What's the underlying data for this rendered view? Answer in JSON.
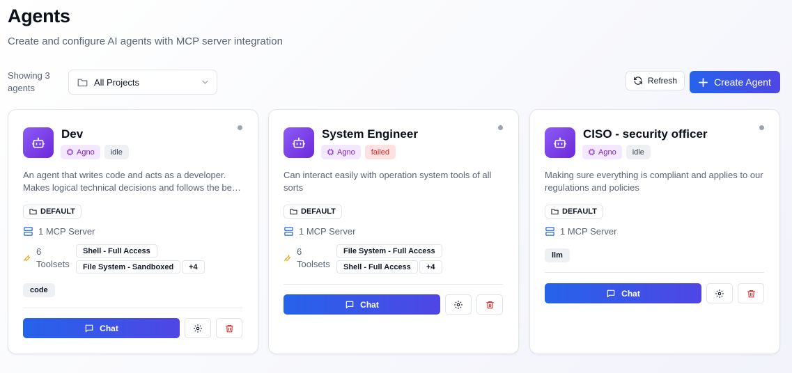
{
  "header": {
    "title": "Agents",
    "subtitle": "Create and configure AI agents with MCP server integration"
  },
  "toolbar": {
    "showing_text": "Showing 3 agents",
    "project_filter": "All Projects",
    "refresh_label": "Refresh",
    "create_label": "Create Agent"
  },
  "colors": {
    "primary": "#2563eb",
    "primary_end": "#4f46e5",
    "avatar": "#7c3aed",
    "framework_badge": "#7e22ce",
    "failed": "#dc2626"
  },
  "agents": [
    {
      "name": "Dev",
      "framework": "Agno",
      "status": "idle",
      "description": "An agent that writes code and acts as a developer. Makes logical technical decisions and follows the best practices",
      "project": "DEFAULT",
      "mcp_servers": "1 MCP Server",
      "toolsets_count": "6 Toolsets",
      "toolsets": [
        "Shell - Full Access",
        "File System - Sandboxed"
      ],
      "toolsets_more": "+4",
      "tags": [
        "code"
      ],
      "chat_label": "Chat"
    },
    {
      "name": "System Engineer",
      "framework": "Agno",
      "status": "failed",
      "description": "Can interact easily with operation system tools of all sorts",
      "project": "DEFAULT",
      "mcp_servers": "1 MCP Server",
      "toolsets_count": "6 Toolsets",
      "toolsets": [
        "File System - Full Access",
        "Shell - Full Access"
      ],
      "toolsets_more": "+4",
      "tags": [],
      "chat_label": "Chat"
    },
    {
      "name": "CISO - security officer",
      "framework": "Agno",
      "status": "idle",
      "description": "Making sure everything is compliant and applies to our regulations and policies",
      "project": "DEFAULT",
      "mcp_servers": "1 MCP Server",
      "toolsets_count": "",
      "toolsets": [],
      "toolsets_more": "",
      "tags": [
        "llm"
      ],
      "chat_label": "Chat"
    }
  ]
}
